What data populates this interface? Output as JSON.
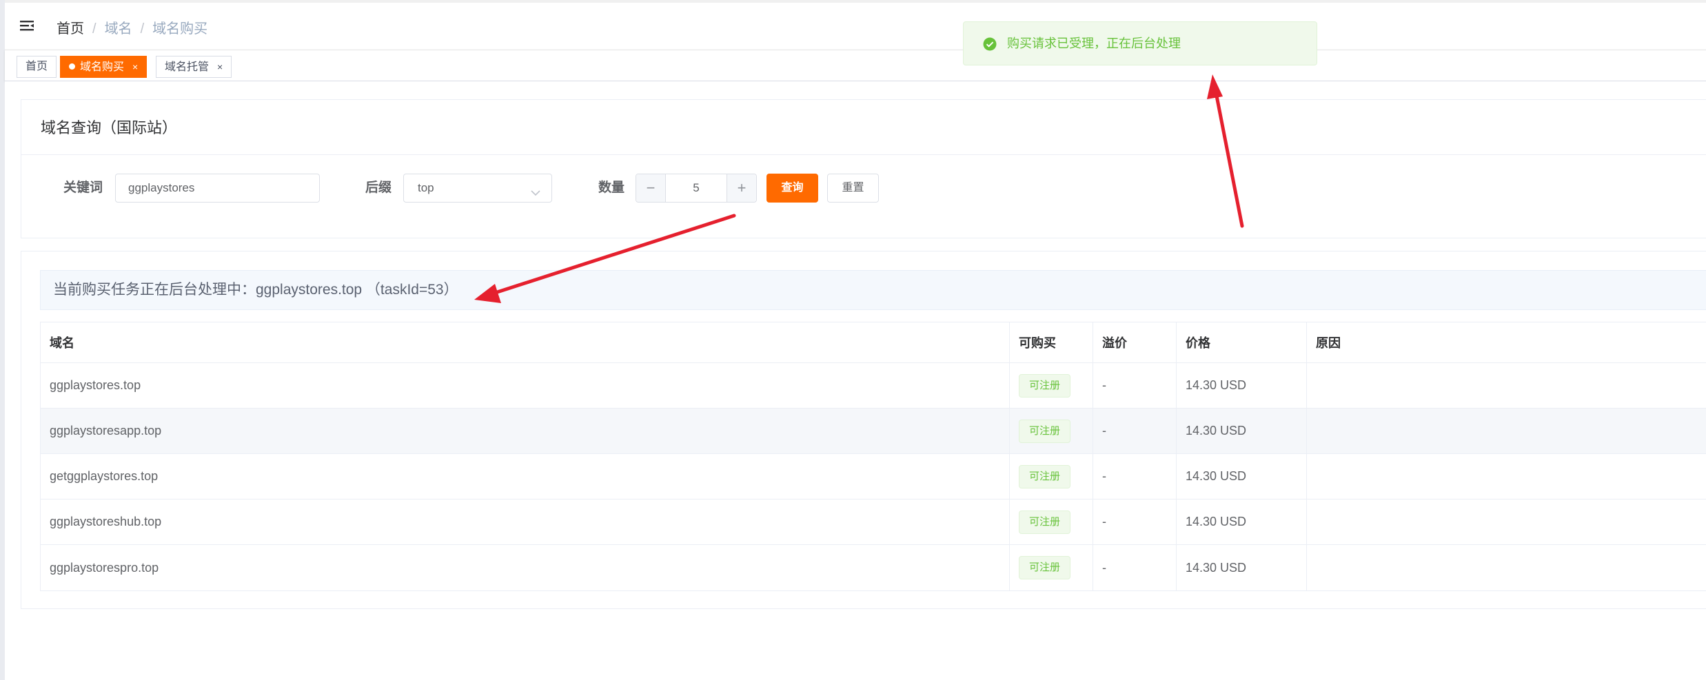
{
  "header": {
    "breadcrumb": [
      "首页",
      "域名",
      "域名购买"
    ],
    "breadcrumb_sep": "/"
  },
  "tags": [
    {
      "label": "首页",
      "active": false
    },
    {
      "label": "域名购买",
      "active": true,
      "close": "×"
    },
    {
      "label": "域名托管",
      "active": false,
      "close": "×"
    }
  ],
  "search_card": {
    "title": "域名查询（国际站）",
    "keyword_label": "关键词",
    "keyword_value": "ggplaystores",
    "suffix_label": "后缀",
    "suffix_value": "top",
    "count_label": "数量",
    "count_value": "5",
    "minus": "−",
    "plus": "+",
    "query_button": "查询",
    "reset_button": "重置"
  },
  "result": {
    "info": "当前购买任务正在后台处理中：ggplaystores.top （taskId=53）",
    "columns": [
      "域名",
      "可购买",
      "溢价",
      "价格",
      "原因"
    ],
    "rows": [
      {
        "domain": "ggplaystores.top",
        "status": "可注册",
        "premium": "-",
        "price": "14.30 USD",
        "reason": ""
      },
      {
        "domain": "ggplaystoresapp.top",
        "status": "可注册",
        "premium": "-",
        "price": "14.30 USD",
        "reason": ""
      },
      {
        "domain": "getggplaystores.top",
        "status": "可注册",
        "premium": "-",
        "price": "14.30 USD",
        "reason": ""
      },
      {
        "domain": "ggplaystoreshub.top",
        "status": "可注册",
        "premium": "-",
        "price": "14.30 USD",
        "reason": ""
      },
      {
        "domain": "ggplaystorespro.top",
        "status": "可注册",
        "premium": "-",
        "price": "14.30 USD",
        "reason": ""
      }
    ]
  },
  "toast": {
    "message": "购买请求已受理，正在后台处理",
    "icon": "success-check-icon",
    "color": "#67c23a"
  },
  "colors": {
    "accent": "#ff6a00",
    "success": "#67c23a",
    "annotation_arrow": "#e5202e"
  }
}
